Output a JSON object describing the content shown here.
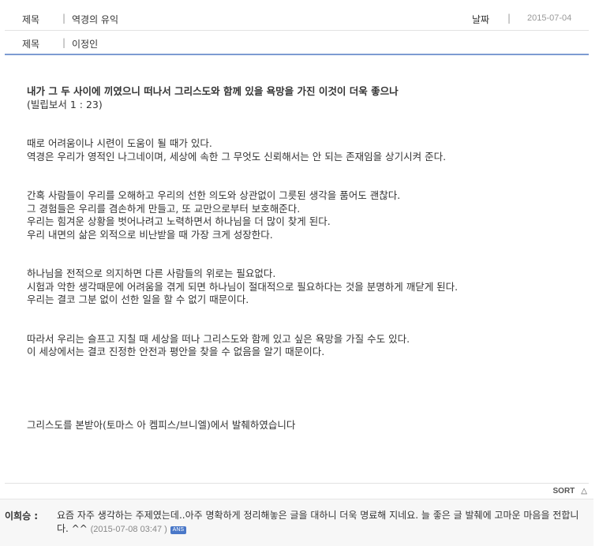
{
  "header": {
    "title_label": "제목",
    "title_value": "역경의 유익",
    "date_label": "날짜",
    "date_value": "2015-07-04",
    "author_label": "제목",
    "author_value": "이정인",
    "separator": "|"
  },
  "body": {
    "title_line": "내가 그 두 사이에 끼였으니 떠나서 그리스도와 함께 있을 욕망을 가진 이것이 더욱 좋으나",
    "reference": "(빌립보서 1 : 23)",
    "para1": [
      "때로 어려움이나 시련이 도움이 될 때가 있다.",
      "역경은 우리가 영적인 나그네이며,  세상에 속한 그 무엇도 신뢰해서는 안 되는 존재임을 상기시켜 준다."
    ],
    "para2": [
      "간혹 사람들이 우리를 오해하고 우리의 선한 의도와 상관없이 그릇된 생각을 품어도 괜찮다.",
      "그 경험들은 우리를 겸손하게 만들고, 또 교만으로부터 보호해준다.",
      "우리는 힘겨운 상황을 벗어나려고 노력하면서 하나님을 더 많이 찾게 된다.",
      "우리 내면의 삶은 외적으로 비난받을 때 가장 크게 성장한다."
    ],
    "para3": [
      "하나님을 전적으로 의지하면 다른 사람들의 위로는 필요없다.",
      "시험과 악한 생각때문에 어려움을 겪게 되면 하나님이 절대적으로 필요하다는 것을 분명하게 깨닫게 된다.",
      "우리는 결코 그분 없이 선한 일을 할 수 없기 때문이다."
    ],
    "para4": [
      "따라서   우리는 슬프고 지칠 때 세상을 떠나 그리스도와 함께 있고 싶은 욕망을 가질 수도 있다.",
      "이 세상에서는 결코 진정한 안전과 평안을 찾을 수 없음을 알기 때문이다."
    ],
    "source": "그리스도를 본받아(토마스 아 켐피스/브니엘)에서 발췌하였습니다"
  },
  "comments": {
    "sort_label": "SORT",
    "sort_icon": "△",
    "items": [
      {
        "author": "이희승 :",
        "text": "요즘 자주 생각하는 주제였는데..아주 명확하게 정리해놓은 글을 대하니 더욱 명료해 지네요. 늘 좋은 글 발췌에 고마운 마음을 전합니다. ^^",
        "date": "(2015-07-08 03:47 )",
        "badge": "ANS"
      }
    ]
  }
}
